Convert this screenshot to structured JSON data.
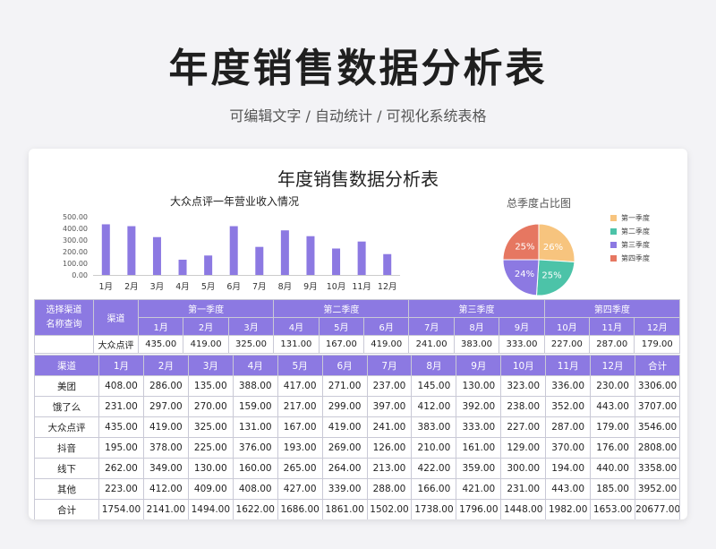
{
  "page": {
    "title": "年度销售数据分析表",
    "subtitle": "可编辑文字 / 自动统计 / 可视化系统表格"
  },
  "card": {
    "title": "年度销售数据分析表"
  },
  "colors": {
    "accent": "#8c79e2",
    "bar": "#8c79e2"
  },
  "chart_data": [
    {
      "type": "bar",
      "title": "大众点评一年营业收入情况",
      "categories": [
        "1月",
        "2月",
        "3月",
        "4月",
        "5月",
        "6月",
        "7月",
        "8月",
        "9月",
        "10月",
        "11月",
        "12月"
      ],
      "values": [
        435.0,
        419.0,
        325.0,
        131.0,
        167.0,
        419.0,
        241.0,
        383.0,
        333.0,
        227.0,
        287.0,
        179.0
      ],
      "yticks": [
        "0.00",
        "100.00",
        "200.00",
        "300.00",
        "400.00",
        "500.00"
      ],
      "ylim": [
        0,
        500
      ],
      "grid": false
    },
    {
      "type": "pie",
      "title": "总季度占比图",
      "slices": [
        {
          "name": "第一季度",
          "label": "26%",
          "value": 26,
          "color": "#f7c47e"
        },
        {
          "name": "第二季度",
          "label": "25%",
          "value": 25,
          "color": "#4cc3a8"
        },
        {
          "name": "第三季度",
          "label": "24%",
          "value": 24,
          "color": "#8c79e2"
        },
        {
          "name": "第四季度",
          "label": "25%",
          "value": 25,
          "color": "#e67761"
        }
      ],
      "legend_position": "right"
    }
  ],
  "query": {
    "select_label_1": "选择渠道",
    "select_label_2": "名称查询",
    "channel_header": "渠道",
    "selected_channel": "大众点评",
    "quarters": [
      "第一季度",
      "第二季度",
      "第三季度",
      "第四季度"
    ],
    "months": [
      "1月",
      "2月",
      "3月",
      "4月",
      "5月",
      "6月",
      "7月",
      "8月",
      "9月",
      "10月",
      "11月",
      "12月"
    ],
    "values": [
      "435.00",
      "419.00",
      "325.00",
      "131.00",
      "167.00",
      "419.00",
      "241.00",
      "383.00",
      "333.00",
      "227.00",
      "287.00",
      "179.00"
    ]
  },
  "table": {
    "headers": [
      "渠道",
      "1月",
      "2月",
      "3月",
      "4月",
      "5月",
      "6月",
      "7月",
      "8月",
      "9月",
      "10月",
      "11月",
      "12月",
      "合计"
    ],
    "rows": [
      [
        "美团",
        "408.00",
        "286.00",
        "135.00",
        "388.00",
        "417.00",
        "271.00",
        "237.00",
        "145.00",
        "130.00",
        "323.00",
        "336.00",
        "230.00",
        "3306.00"
      ],
      [
        "饿了么",
        "231.00",
        "297.00",
        "270.00",
        "159.00",
        "217.00",
        "299.00",
        "397.00",
        "412.00",
        "392.00",
        "238.00",
        "352.00",
        "443.00",
        "3707.00"
      ],
      [
        "大众点评",
        "435.00",
        "419.00",
        "325.00",
        "131.00",
        "167.00",
        "419.00",
        "241.00",
        "383.00",
        "333.00",
        "227.00",
        "287.00",
        "179.00",
        "3546.00"
      ],
      [
        "抖音",
        "195.00",
        "378.00",
        "225.00",
        "376.00",
        "193.00",
        "269.00",
        "126.00",
        "210.00",
        "161.00",
        "129.00",
        "370.00",
        "176.00",
        "2808.00"
      ],
      [
        "线下",
        "262.00",
        "349.00",
        "130.00",
        "160.00",
        "265.00",
        "264.00",
        "213.00",
        "422.00",
        "359.00",
        "300.00",
        "194.00",
        "440.00",
        "3358.00"
      ],
      [
        "其他",
        "223.00",
        "412.00",
        "409.00",
        "408.00",
        "427.00",
        "339.00",
        "288.00",
        "166.00",
        "421.00",
        "231.00",
        "443.00",
        "185.00",
        "3952.00"
      ],
      [
        "合计",
        "1754.00",
        "2141.00",
        "1494.00",
        "1622.00",
        "1686.00",
        "1861.00",
        "1502.00",
        "1738.00",
        "1796.00",
        "1448.00",
        "1982.00",
        "1653.00",
        "20677.00"
      ]
    ]
  }
}
